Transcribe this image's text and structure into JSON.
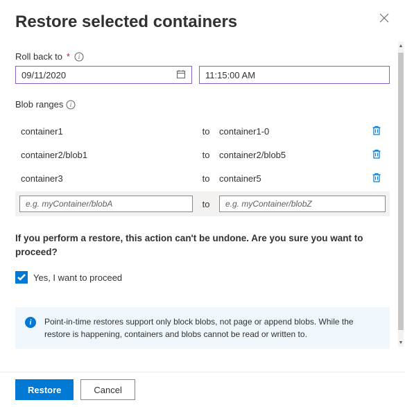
{
  "title": "Restore selected containers",
  "rollback": {
    "label": "Roll back to",
    "date": "09/11/2020",
    "time": "11:15:00 AM"
  },
  "ranges": {
    "label": "Blob ranges",
    "to_label": "to",
    "rows": [
      {
        "from": "container1",
        "dest": "container1-0"
      },
      {
        "from": "container2/blob1",
        "dest": "container2/blob5"
      },
      {
        "from": "container3",
        "dest": "container5"
      }
    ],
    "input": {
      "placeholder_from": "e.g. myContainer/blobA",
      "placeholder_to": "e.g. myContainer/blobZ"
    }
  },
  "warning": "If you perform a restore, this action can't be undone. Are you sure you want to proceed?",
  "consent": {
    "label": "Yes, I want to proceed",
    "checked": true
  },
  "info": "Point-in-time restores support only block blobs, not page or append blobs. While the restore is happening, containers and blobs cannot be read or written to.",
  "buttons": {
    "primary": "Restore",
    "secondary": "Cancel"
  }
}
